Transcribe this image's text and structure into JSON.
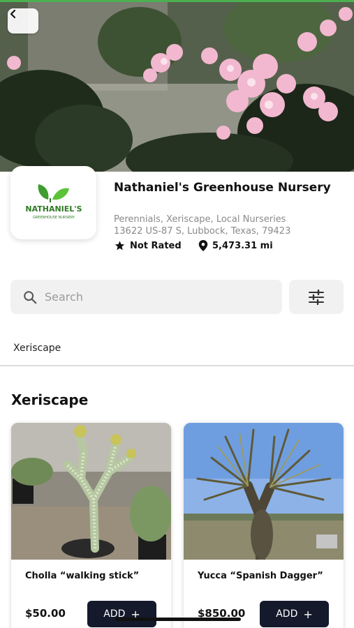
{
  "header": {
    "back_icon": "chevron-left-icon",
    "accent_color": "#4caf50"
  },
  "store": {
    "logo_text": "NATHANIEL'S",
    "logo_subtext": "GREENHOUSE NURSERY",
    "name": "Nathaniel's Greenhouse Nursery",
    "categories": "Perennials, Xeriscape, Local Nurseries",
    "address": "13622 US-87 S, Lubbock, Texas, 79423",
    "rating": "Not Rated",
    "distance": "5,473.31 mi"
  },
  "search": {
    "placeholder": "Search",
    "icon": "search-icon",
    "filter_icon": "sliders-icon"
  },
  "tabs": [
    {
      "label": "Xeriscape"
    }
  ],
  "section": {
    "title": "Xeriscape"
  },
  "products": [
    {
      "name": "Cholla “walking stick”",
      "price": "$50.00",
      "button": "ADD"
    },
    {
      "name": "Yucca “Spanish Dagger”",
      "price": "$850.00",
      "button": "ADD"
    }
  ],
  "colors": {
    "button_bg": "#141a2b",
    "muted_text": "#8a8a8a",
    "input_bg": "#f1f1f2"
  }
}
